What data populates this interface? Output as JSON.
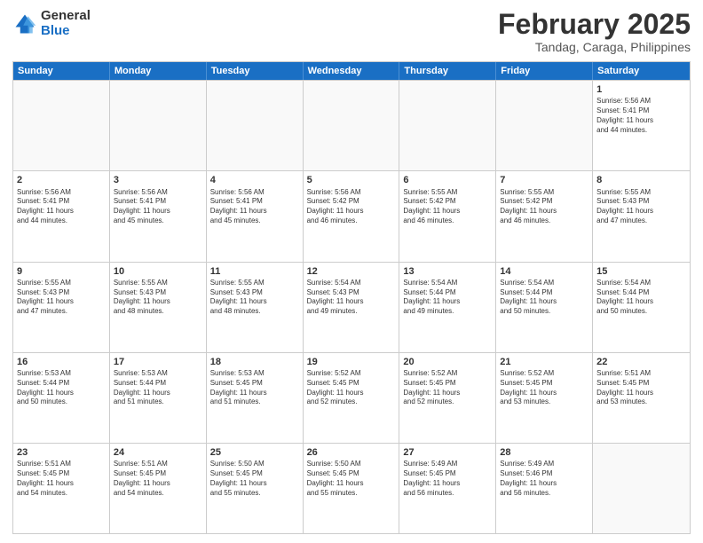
{
  "logo": {
    "general": "General",
    "blue": "Blue"
  },
  "header": {
    "month": "February 2025",
    "location": "Tandag, Caraga, Philippines"
  },
  "days": [
    "Sunday",
    "Monday",
    "Tuesday",
    "Wednesday",
    "Thursday",
    "Friday",
    "Saturday"
  ],
  "rows": [
    [
      {
        "day": "",
        "info": ""
      },
      {
        "day": "",
        "info": ""
      },
      {
        "day": "",
        "info": ""
      },
      {
        "day": "",
        "info": ""
      },
      {
        "day": "",
        "info": ""
      },
      {
        "day": "",
        "info": ""
      },
      {
        "day": "1",
        "info": "Sunrise: 5:56 AM\nSunset: 5:41 PM\nDaylight: 11 hours\nand 44 minutes."
      }
    ],
    [
      {
        "day": "2",
        "info": "Sunrise: 5:56 AM\nSunset: 5:41 PM\nDaylight: 11 hours\nand 44 minutes."
      },
      {
        "day": "3",
        "info": "Sunrise: 5:56 AM\nSunset: 5:41 PM\nDaylight: 11 hours\nand 45 minutes."
      },
      {
        "day": "4",
        "info": "Sunrise: 5:56 AM\nSunset: 5:41 PM\nDaylight: 11 hours\nand 45 minutes."
      },
      {
        "day": "5",
        "info": "Sunrise: 5:56 AM\nSunset: 5:42 PM\nDaylight: 11 hours\nand 46 minutes."
      },
      {
        "day": "6",
        "info": "Sunrise: 5:55 AM\nSunset: 5:42 PM\nDaylight: 11 hours\nand 46 minutes."
      },
      {
        "day": "7",
        "info": "Sunrise: 5:55 AM\nSunset: 5:42 PM\nDaylight: 11 hours\nand 46 minutes."
      },
      {
        "day": "8",
        "info": "Sunrise: 5:55 AM\nSunset: 5:43 PM\nDaylight: 11 hours\nand 47 minutes."
      }
    ],
    [
      {
        "day": "9",
        "info": "Sunrise: 5:55 AM\nSunset: 5:43 PM\nDaylight: 11 hours\nand 47 minutes."
      },
      {
        "day": "10",
        "info": "Sunrise: 5:55 AM\nSunset: 5:43 PM\nDaylight: 11 hours\nand 48 minutes."
      },
      {
        "day": "11",
        "info": "Sunrise: 5:55 AM\nSunset: 5:43 PM\nDaylight: 11 hours\nand 48 minutes."
      },
      {
        "day": "12",
        "info": "Sunrise: 5:54 AM\nSunset: 5:43 PM\nDaylight: 11 hours\nand 49 minutes."
      },
      {
        "day": "13",
        "info": "Sunrise: 5:54 AM\nSunset: 5:44 PM\nDaylight: 11 hours\nand 49 minutes."
      },
      {
        "day": "14",
        "info": "Sunrise: 5:54 AM\nSunset: 5:44 PM\nDaylight: 11 hours\nand 50 minutes."
      },
      {
        "day": "15",
        "info": "Sunrise: 5:54 AM\nSunset: 5:44 PM\nDaylight: 11 hours\nand 50 minutes."
      }
    ],
    [
      {
        "day": "16",
        "info": "Sunrise: 5:53 AM\nSunset: 5:44 PM\nDaylight: 11 hours\nand 50 minutes."
      },
      {
        "day": "17",
        "info": "Sunrise: 5:53 AM\nSunset: 5:44 PM\nDaylight: 11 hours\nand 51 minutes."
      },
      {
        "day": "18",
        "info": "Sunrise: 5:53 AM\nSunset: 5:45 PM\nDaylight: 11 hours\nand 51 minutes."
      },
      {
        "day": "19",
        "info": "Sunrise: 5:52 AM\nSunset: 5:45 PM\nDaylight: 11 hours\nand 52 minutes."
      },
      {
        "day": "20",
        "info": "Sunrise: 5:52 AM\nSunset: 5:45 PM\nDaylight: 11 hours\nand 52 minutes."
      },
      {
        "day": "21",
        "info": "Sunrise: 5:52 AM\nSunset: 5:45 PM\nDaylight: 11 hours\nand 53 minutes."
      },
      {
        "day": "22",
        "info": "Sunrise: 5:51 AM\nSunset: 5:45 PM\nDaylight: 11 hours\nand 53 minutes."
      }
    ],
    [
      {
        "day": "23",
        "info": "Sunrise: 5:51 AM\nSunset: 5:45 PM\nDaylight: 11 hours\nand 54 minutes."
      },
      {
        "day": "24",
        "info": "Sunrise: 5:51 AM\nSunset: 5:45 PM\nDaylight: 11 hours\nand 54 minutes."
      },
      {
        "day": "25",
        "info": "Sunrise: 5:50 AM\nSunset: 5:45 PM\nDaylight: 11 hours\nand 55 minutes."
      },
      {
        "day": "26",
        "info": "Sunrise: 5:50 AM\nSunset: 5:45 PM\nDaylight: 11 hours\nand 55 minutes."
      },
      {
        "day": "27",
        "info": "Sunrise: 5:49 AM\nSunset: 5:45 PM\nDaylight: 11 hours\nand 56 minutes."
      },
      {
        "day": "28",
        "info": "Sunrise: 5:49 AM\nSunset: 5:46 PM\nDaylight: 11 hours\nand 56 minutes."
      },
      {
        "day": "",
        "info": ""
      }
    ]
  ]
}
